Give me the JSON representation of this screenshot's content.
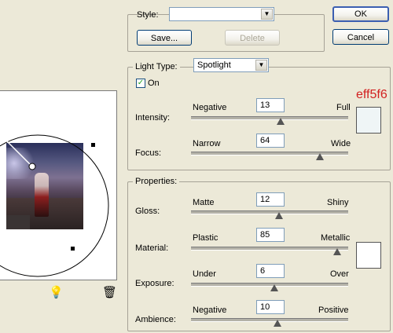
{
  "style": {
    "label": "Style:",
    "value": ""
  },
  "buttons": {
    "ok": "OK",
    "cancel": "Cancel",
    "save": "Save...",
    "delete": "Delete"
  },
  "light": {
    "type_label": "Light Type:",
    "type_value": "Spotlight",
    "on_label": "On",
    "on_checked": true,
    "intensity": {
      "label": "Intensity:",
      "min": "Negative",
      "max": "Full",
      "value": "13",
      "level": 0.57
    },
    "focus": {
      "label": "Focus:",
      "min": "Narrow",
      "max": "Wide",
      "value": "64",
      "level": 0.82
    },
    "color_hex": "eff5f6",
    "color_label_color": "#d21f1f",
    "swatch_color": "#eff5f6"
  },
  "properties": {
    "title": "Properties:",
    "gloss": {
      "label": "Gloss:",
      "min": "Matte",
      "max": "Shiny",
      "value": "12",
      "level": 0.56
    },
    "material": {
      "label": "Material:",
      "min": "Plastic",
      "max": "Metallic",
      "value": "85",
      "level": 0.93
    },
    "exposure": {
      "label": "Exposure:",
      "min": "Under",
      "max": "Over",
      "value": "6",
      "level": 0.53
    },
    "ambience": {
      "label": "Ambience:",
      "min": "Negative",
      "max": "Positive",
      "value": "10",
      "level": 0.55
    },
    "swatch_color": "#ffffff"
  },
  "icons": {
    "light": "lightbulb-icon",
    "trash": "trash-icon"
  }
}
